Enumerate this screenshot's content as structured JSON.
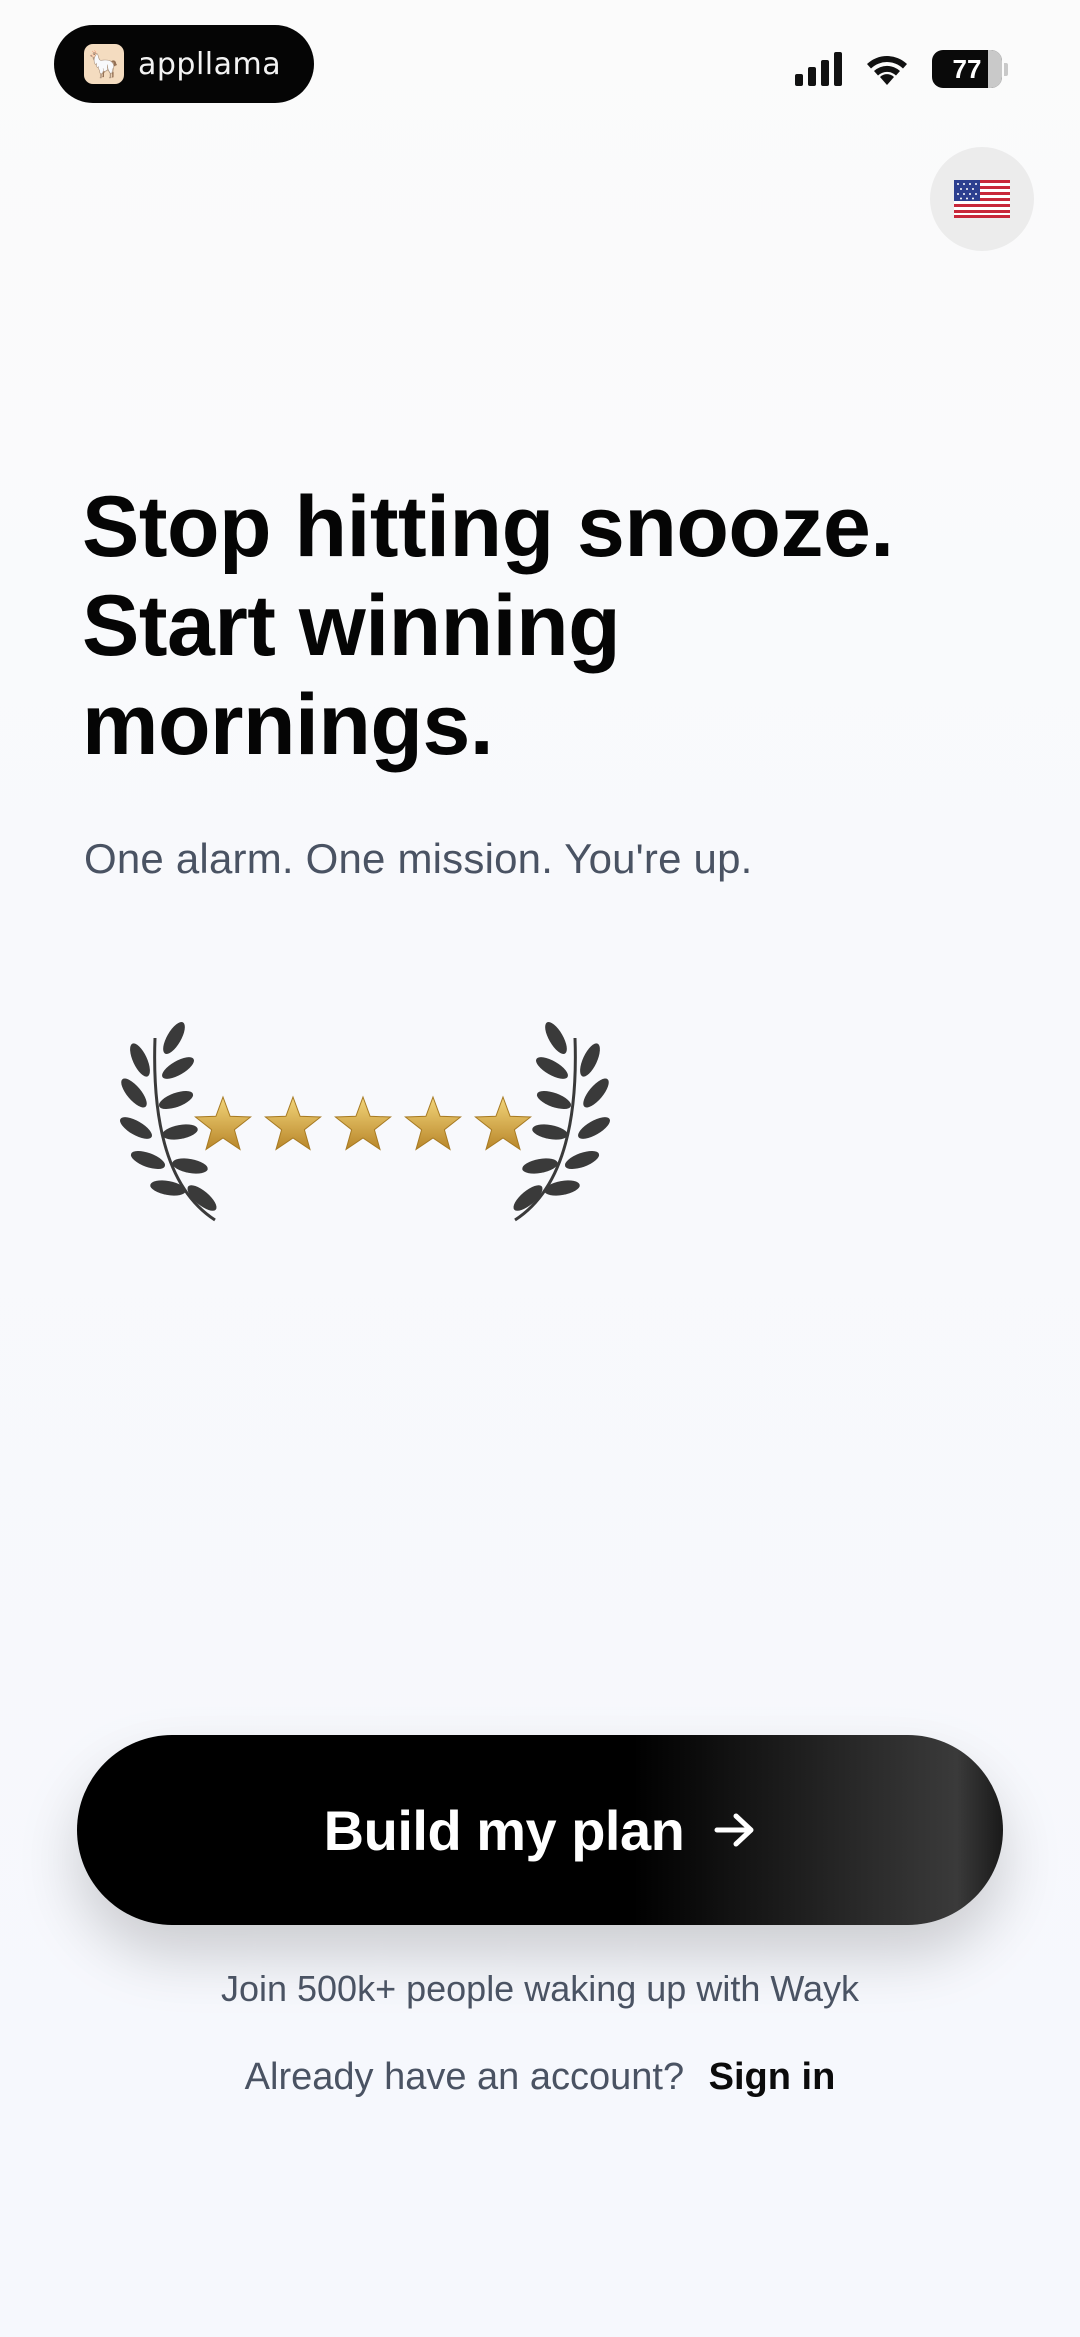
{
  "status_bar": {
    "brand_name": "appllama",
    "battery_level": "77",
    "signal_bars": 4,
    "wifi": true
  },
  "language": {
    "flag_emoji": "🇺🇸",
    "icon": "us-flag-icon"
  },
  "hero": {
    "headline_lines": [
      "Stop hitting snooze.",
      "Start winning",
      "mornings."
    ],
    "subtitle": "One alarm. One mission. You're up."
  },
  "rating": {
    "stars": 5,
    "max_stars": 5,
    "star_color": "#d9b04a",
    "laurel_color": "#3a3a3a"
  },
  "cta": {
    "label": "Build my plan",
    "icon": "arrow-right-icon"
  },
  "footer": {
    "social_proof": "Join 500k+ people waking up with Wayk",
    "signin_prompt": "Already have an account?",
    "signin_link": "Sign in"
  }
}
